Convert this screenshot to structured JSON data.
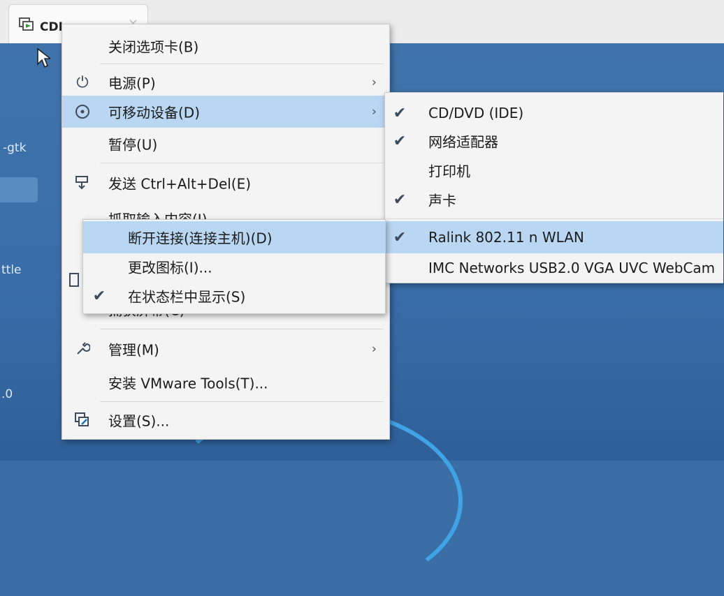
{
  "tab": {
    "title": "CDI",
    "close_glyph": "×"
  },
  "desktop": {
    "label_gtk": "-gtk",
    "label_ttle": "ttle",
    "label_0": ".0"
  },
  "main_menu": {
    "items": [
      {
        "label": "关闭选项卡(B)"
      },
      {
        "label": "电源(P)",
        "arrow": "›"
      },
      {
        "label": "可移动设备(D)",
        "arrow": "›"
      },
      {
        "label": "暂停(U)"
      },
      {
        "label": "发送 Ctrl+Alt+Del(E)"
      },
      {
        "label": "抓取输入内容(I)"
      },
      {
        "label": "捕获屏幕(C)"
      },
      {
        "label": "管理(M)",
        "arrow": "›"
      },
      {
        "label": "安装 VMware Tools(T)..."
      },
      {
        "label": "设置(S)..."
      }
    ]
  },
  "device_menu": {
    "items": [
      {
        "label": "CD/DVD (IDE)",
        "checked": "✔"
      },
      {
        "label": "网络适配器",
        "checked": "✔"
      },
      {
        "label": "打印机",
        "checked": ""
      },
      {
        "label": "声卡",
        "checked": "✔"
      },
      {
        "label": "Ralink 802.11 n WLAN",
        "checked": "✔"
      },
      {
        "label": "IMC Networks USB2.0 VGA UVC WebCam",
        "checked": ""
      }
    ]
  },
  "sub_menu": {
    "items": [
      {
        "label": "断开连接(连接主机)(D)",
        "checked": ""
      },
      {
        "label": "更改图标(I)...",
        "checked": ""
      },
      {
        "label": "在状态栏中显示(S)",
        "checked": "✔"
      }
    ]
  },
  "colors": {
    "highlight": "#b9d7f3",
    "check": "#1a6fc4",
    "desktop": "#3a6ea5"
  }
}
